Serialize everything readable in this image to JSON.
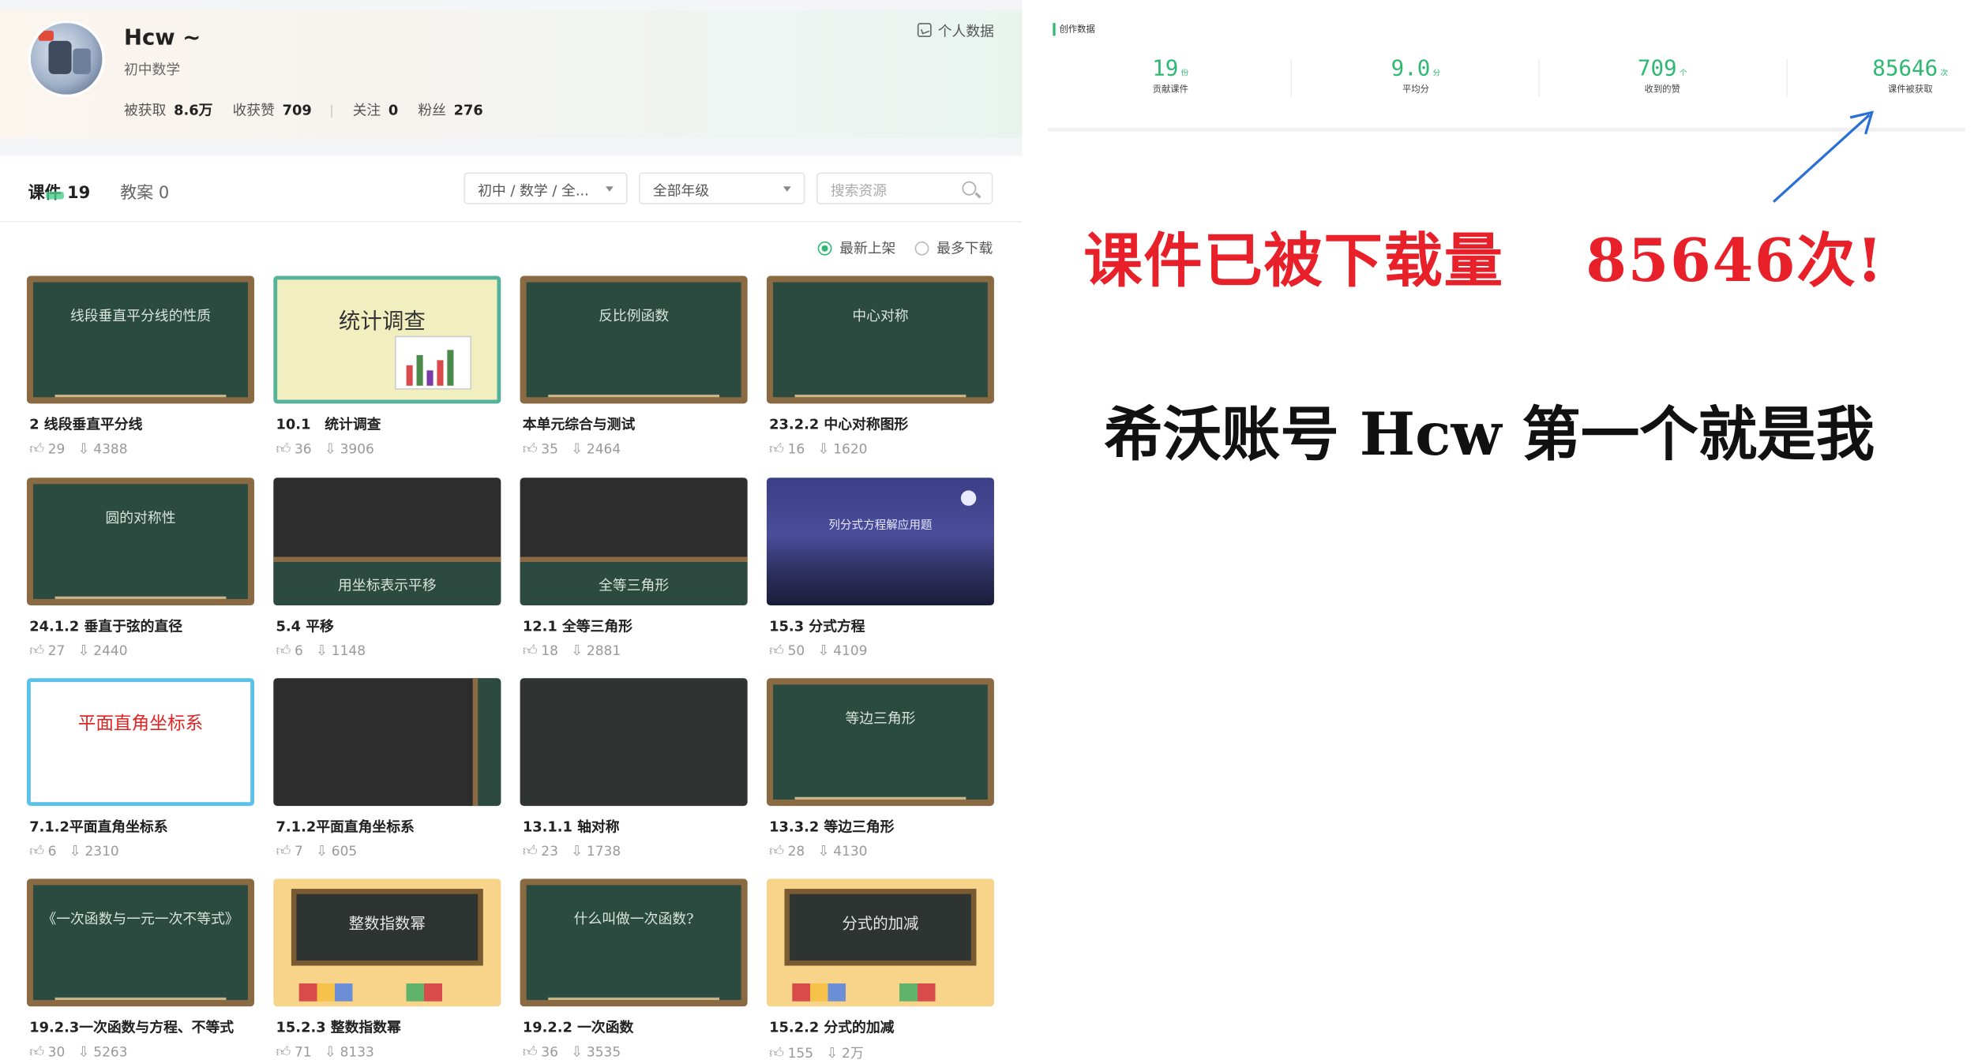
{
  "profile": {
    "name": "Hcw ~",
    "subject": "初中数学",
    "stats": [
      {
        "label": "被获取",
        "value": "8.6万"
      },
      {
        "label": "收获赞",
        "value": "709"
      },
      {
        "label": "关注",
        "value": "0"
      },
      {
        "label": "粉丝",
        "value": "276"
      }
    ],
    "personal_data_link": "个人数据"
  },
  "tabs": [
    {
      "label": "课件",
      "count": "19"
    },
    {
      "label": "教案",
      "count": "0"
    }
  ],
  "filters": {
    "subject_select": "初中 / 数学 / 全...",
    "grade_select": "全部年级",
    "search_placeholder": "搜索资源"
  },
  "sort": {
    "newest": "最新上架",
    "most_downloaded": "最多下载",
    "selected": "newest"
  },
  "cards": [
    {
      "title": "2 线段垂直平分线",
      "likes": "29",
      "downloads": "4388",
      "thumb_text": "线段垂直平分线的性质",
      "style": "board"
    },
    {
      "title": "10.1　统计调查",
      "likes": "36",
      "downloads": "3906",
      "thumb_text": "统计调查",
      "style": "cream"
    },
    {
      "title": "本单元综合与测试",
      "likes": "35",
      "downloads": "2464",
      "thumb_text": "反比例函数",
      "style": "board"
    },
    {
      "title": "23.2.2 中心对称图形",
      "likes": "16",
      "downloads": "1620",
      "thumb_text": "中心对称",
      "style": "board"
    },
    {
      "title": "24.1.2 垂直于弦的直径",
      "likes": "27",
      "downloads": "2440",
      "thumb_text": "圆的对称性",
      "style": "board"
    },
    {
      "title": "5.4 平移",
      "likes": "6",
      "downloads": "1148",
      "thumb_text": "用坐标表示平移",
      "style": "dark"
    },
    {
      "title": "12.1 全等三角形",
      "likes": "18",
      "downloads": "2881",
      "thumb_text": "全等三角形",
      "style": "dark"
    },
    {
      "title": "15.3 分式方程",
      "likes": "50",
      "downloads": "4109",
      "thumb_text": "列分式方程解应用题",
      "style": "night"
    },
    {
      "title": "7.1.2平面直角坐标系",
      "likes": "6",
      "downloads": "2310",
      "thumb_text": "平面直角坐标系",
      "style": "white"
    },
    {
      "title": "7.1.2平面直角坐标系",
      "likes": "7",
      "downloads": "605",
      "thumb_text": "",
      "style": "darkside"
    },
    {
      "title": "13.1.1 轴对称",
      "likes": "23",
      "downloads": "1738",
      "thumb_text": "",
      "style": "darkplain"
    },
    {
      "title": "13.3.2 等边三角形",
      "likes": "28",
      "downloads": "4130",
      "thumb_text": "等边三角形",
      "style": "board"
    },
    {
      "title": "19.2.3一次函数与方程、不等式",
      "likes": "30",
      "downloads": "5263",
      "thumb_text": "《一次函数与一元一次不等式》",
      "style": "board"
    },
    {
      "title": "15.2.3 整数指数幂",
      "likes": "71",
      "downloads": "8133",
      "thumb_text": "整数指数幂",
      "style": "yellow"
    },
    {
      "title": "19.2.2 一次函数",
      "likes": "36",
      "downloads": "3535",
      "thumb_text": "什么叫做一次函数?",
      "style": "board"
    },
    {
      "title": "15.2.2 分式的加减",
      "likes": "155",
      "downloads": "2万",
      "thumb_text": "分式的加减",
      "style": "yellow"
    }
  ],
  "creation": {
    "label": "创作数据",
    "stats": [
      {
        "value": "19",
        "unit": "份",
        "label": "贡献课件"
      },
      {
        "value": "9.0",
        "unit": "分",
        "label": "平均分"
      },
      {
        "value": "709",
        "unit": "个",
        "label": "收到的赞"
      },
      {
        "value": "85646",
        "unit": "次",
        "label": "课件被获取"
      }
    ]
  },
  "headline1": "课件已被下载量　 85646次!",
  "headline2": "希沃账号 Hcw 第一个就是我",
  "colors": {
    "accent_green": "#2eb872",
    "headline_red": "#e8202a",
    "arrow_blue": "#2a6fd6"
  }
}
